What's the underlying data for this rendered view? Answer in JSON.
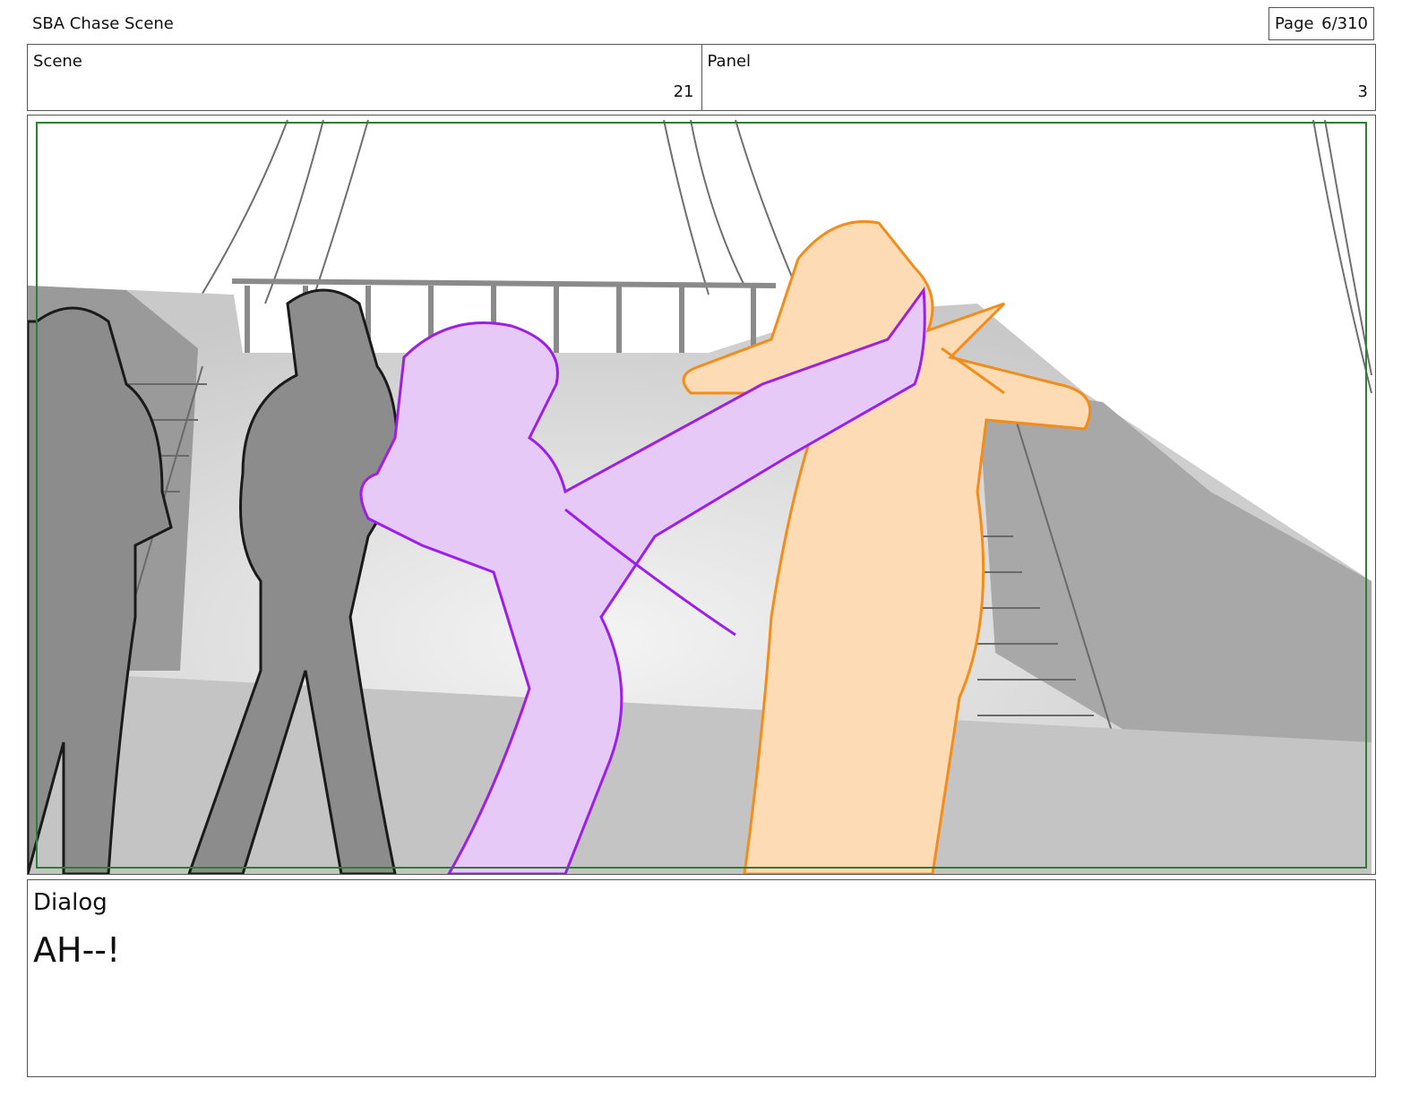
{
  "document": {
    "project_title": "SBA Chase Scene",
    "page_label": "Page",
    "page_number": "6/310"
  },
  "header": {
    "scene_label": "Scene",
    "scene_number": "21",
    "panel_label": "Panel",
    "panel_number": "3"
  },
  "panel": {
    "safe_frame_color": "#2e7d32",
    "figure_colors": {
      "purple_character": "#9b1fe8",
      "purple_fill": "#e6c9f7",
      "orange_character": "#f28c1a",
      "orange_fill": "#fddcb5",
      "thugs": "#777777"
    }
  },
  "dialog": {
    "label": "Dialog",
    "text": "AH--!"
  }
}
